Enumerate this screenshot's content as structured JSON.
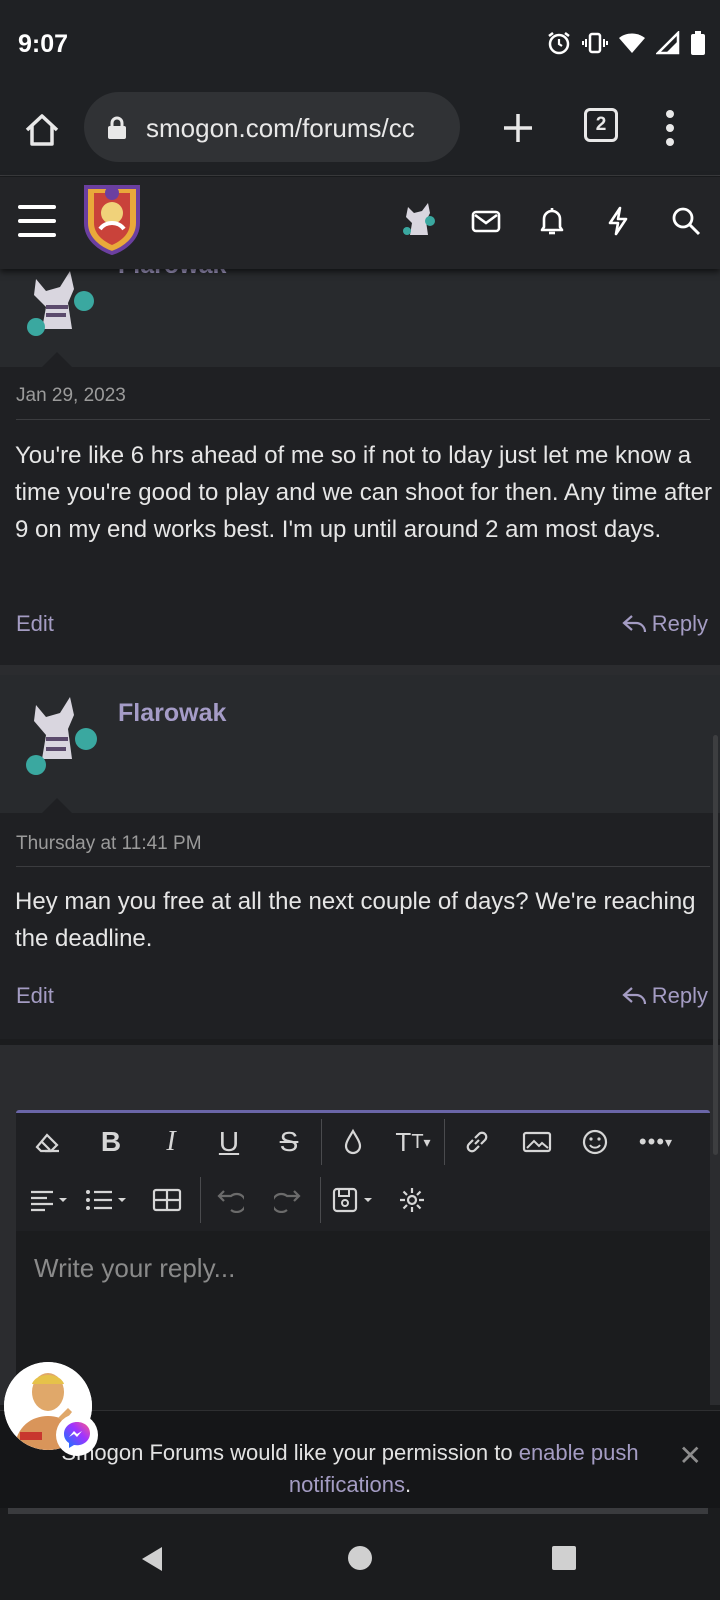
{
  "status_bar": {
    "time": "9:07"
  },
  "browser": {
    "url": "smogon.com/forums/cc",
    "tab_count": "2"
  },
  "site_nav": {
    "icons": [
      "menu-icon",
      "envelope-icon",
      "bell-icon",
      "lightning-icon",
      "search-icon"
    ]
  },
  "posts": [
    {
      "username": "Flarowak",
      "date": "Jan 29, 2023",
      "message": "You're like 6 hrs ahead of me so if not to lday just let me know a time you're good to play and we can shoot for then. Any time after 9 on my end works best. I'm up until around 2 am most days.",
      "edit_label": "Edit",
      "reply_label": "Reply"
    },
    {
      "username": "Flarowak",
      "date": "Thursday at 11:41 PM",
      "message": "Hey man you free at all the next couple of days? We're reaching the deadline.",
      "edit_label": "Edit",
      "reply_label": "Reply"
    }
  ],
  "editor": {
    "placeholder": "Write your reply..."
  },
  "push_banner": {
    "text_before": "Smogon Forums would like your permission to ",
    "link_text": "enable push notifications",
    "text_after": "."
  },
  "colors": {
    "accent": "#a59cc7",
    "background": "#1b1c1e",
    "link": "#a49cc3",
    "editor_border": "#6a66a8"
  }
}
